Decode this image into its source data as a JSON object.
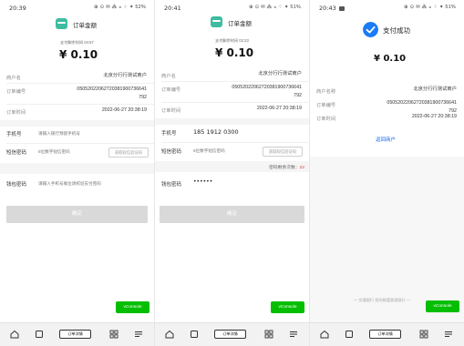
{
  "screens": [
    {
      "status_time": "20:39",
      "status_sys": "⊕ ⊙ ✉ ⁂ ◒ ⁘ ✦ 52%",
      "header_title": "订单金额",
      "pay_time_text": "支付剩余时间 04:57",
      "amount": "¥ 0.10",
      "merchant_label": "商户名",
      "merchant_value": "北京分行行测试商户",
      "order_no_label": "订单编号",
      "order_no_line1": "05052022062720381900736641",
      "order_no_line2": "792",
      "order_time_label": "订单时间",
      "order_time_value": "2022-06-27 20:38:19",
      "phone_label": "手机号",
      "phone_placeholder": "请输入银行预留手机号",
      "sms_label": "短信密码",
      "sms_placeholder": "6位数字短信密码",
      "get_code_label": "获取短信验证码",
      "pwd_label": "钱包密码",
      "pwd_placeholder": "请输入手机号尾位请校验支付密码",
      "confirm_label": "确定",
      "vconsole_label": "vConsole",
      "nav_pill_label": "订单详情"
    },
    {
      "status_time": "20:41",
      "status_sys": "⊕ ⊙ ✉ ⁂ ◒ ⁘ ✦ 51%",
      "header_title": "订单金额",
      "pay_time_text": "支付剩余时间 02:23",
      "amount": "¥ 0.10",
      "merchant_label": "商户名",
      "merchant_value": "北京分行行测试商户",
      "order_no_label": "订单编号",
      "order_no_line1": "05052022062720381900736641",
      "order_no_line2": "792",
      "order_time_label": "订单时间",
      "order_time_value": "2022-06-27 20:38:19",
      "phone_label": "手机号",
      "phone_value": "185 1912 0300",
      "sms_label": "短信密码",
      "sms_placeholder": "6位数字短信密码",
      "get_code_label": "获取短信验证码",
      "retry_label": "密码剩余次数：",
      "retry_count": "22",
      "pwd_label": "钱包密码",
      "pwd_value": "••••••",
      "confirm_label": "确定",
      "vconsole_label": "vConsole",
      "nav_pill_label": "订单详情"
    },
    {
      "status_time": "20:43",
      "status_sys": "⊕ ⊙ ✉ ⁂ ◒ ⁘ ✦ 51%",
      "success_title": "支付成功",
      "amount": "¥ 0.10",
      "merchant_label": "商户名称",
      "merchant_value": "北京分行行测试商户",
      "order_no_label": "订单编号",
      "order_no_line1": "05052022062720381900736641",
      "order_no_line2": "792",
      "order_time_label": "订单时间",
      "order_time_value": "2022-06-27 20:38:19",
      "return_label": "返回商户",
      "footer_note": "一 交通银行 您的财富管理银行 一",
      "vconsole_label": "vConsole",
      "nav_pill_label": "订单详情"
    }
  ],
  "colors": {
    "brand_teal": "#3dbca1",
    "vconsole_green": "#04be02",
    "success_blue": "#1a7cf6",
    "link_blue": "#1a6cf0",
    "retry_red": "#e03b3b",
    "disabled_button": "#d9d9d9"
  },
  "icons": {
    "header": "wallet-icon",
    "success": "check-circle-icon",
    "nav": [
      "home-icon",
      "square-icon",
      "grid-icon",
      "menu-icon"
    ]
  }
}
